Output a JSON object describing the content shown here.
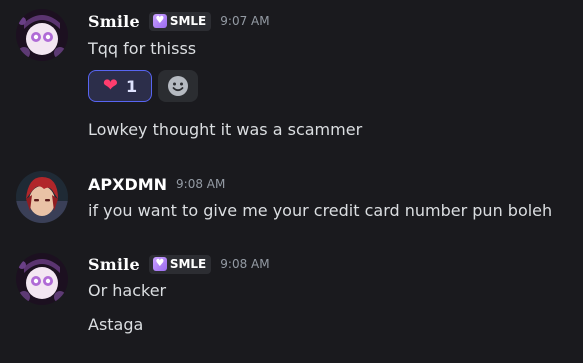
{
  "messages": [
    {
      "author": "Smile",
      "tag": "SMLE",
      "tag_icon": "heart-icon",
      "time": "9:07 AM",
      "lines": [
        "Tqq for thisss",
        "Lowkey thought it was a scammer"
      ],
      "reactions": [
        {
          "emoji": "sparkling-heart-emoji",
          "glyph": "❤",
          "count": "1",
          "active": true
        }
      ],
      "add_reaction_icon": "add-reaction-icon"
    },
    {
      "author": "APXDMN",
      "time": "9:08 AM",
      "lines": [
        "if you want to give me your credit card number pun boleh"
      ]
    },
    {
      "author": "Smile",
      "tag": "SMLE",
      "tag_icon": "heart-icon",
      "time": "9:08 AM",
      "lines": [
        "Or hacker",
        "Astaga"
      ]
    }
  ],
  "colors": {
    "background": "#1a1a1e",
    "text": "#dbdee1",
    "timestamp": "#949ba4",
    "reaction_active_border": "#5865f2",
    "tag_background": "#2c2d32"
  }
}
